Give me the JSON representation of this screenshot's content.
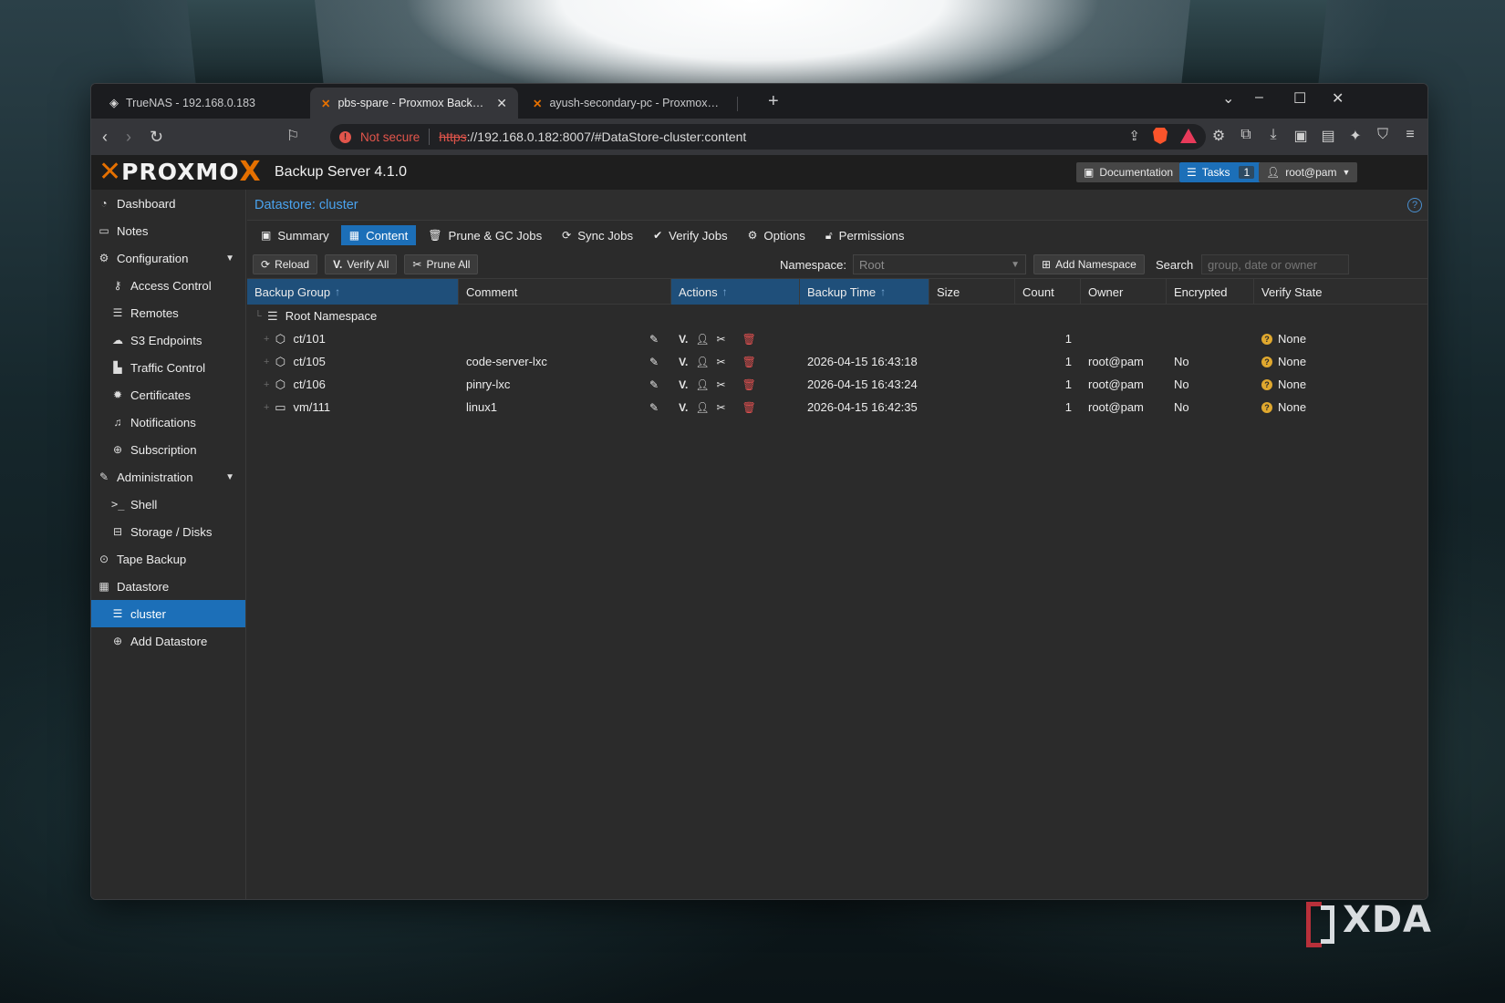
{
  "browser": {
    "tabs": [
      {
        "title": "TrueNAS - 192.168.0.183",
        "icon": "truenas-icon",
        "active": false
      },
      {
        "title": "pbs-spare - Proxmox Backup Ser",
        "icon": "proxmox-icon",
        "active": true
      },
      {
        "title": "ayush-secondary-pc - Proxmox Virtu",
        "icon": "proxmox-icon",
        "active": false
      }
    ],
    "security_label": "Not secure",
    "url_scheme": "https",
    "url_rest": "://192.168.0.182:8007/#DataStore-cluster:content"
  },
  "app": {
    "logo_text_left": "PRO",
    "logo_text_o": "O",
    "logo_text_right": "M",
    "logo_text_end": "X",
    "product": "Backup Server 4.1.0",
    "documentation_label": "Documentation",
    "tasks_label": "Tasks",
    "tasks_count": "1",
    "user_label": "root@pam"
  },
  "sidebar": {
    "items": [
      {
        "label": "Dashboard",
        "icon": "dashboard-icon"
      },
      {
        "label": "Notes",
        "icon": "notes-icon"
      },
      {
        "label": "Configuration",
        "icon": "gears-icon"
      },
      {
        "label": "Access Control",
        "icon": "key-icon"
      },
      {
        "label": "Remotes",
        "icon": "server-icon"
      },
      {
        "label": "S3 Endpoints",
        "icon": "cloud-icon"
      },
      {
        "label": "Traffic Control",
        "icon": "chart-icon"
      },
      {
        "label": "Certificates",
        "icon": "certificate-icon"
      },
      {
        "label": "Notifications",
        "icon": "bell-icon"
      },
      {
        "label": "Subscription",
        "icon": "support-icon"
      },
      {
        "label": "Administration",
        "icon": "wrench-icon"
      },
      {
        "label": "Shell",
        "icon": "terminal-icon"
      },
      {
        "label": "Storage / Disks",
        "icon": "hdd-icon"
      },
      {
        "label": "Tape Backup",
        "icon": "tape-icon"
      },
      {
        "label": "Datastore",
        "icon": "archive-icon"
      },
      {
        "label": "cluster",
        "icon": "database-icon"
      },
      {
        "label": "Add Datastore",
        "icon": "plus-circle-icon"
      }
    ]
  },
  "datastore": {
    "title": "Datastore: cluster",
    "tabs": [
      "Summary",
      "Content",
      "Prune & GC Jobs",
      "Sync Jobs",
      "Verify Jobs",
      "Options",
      "Permissions"
    ],
    "toolbar": {
      "reload": "Reload",
      "verify_all": "Verify All",
      "prune_all": "Prune All",
      "namespace_label": "Namespace:",
      "namespace_value": "Root",
      "add_namespace": "Add Namespace",
      "search_label": "Search",
      "search_placeholder": "group, date or owner"
    },
    "columns": [
      "Backup Group",
      "Comment",
      "Actions",
      "Backup Time",
      "Size",
      "Count",
      "Owner",
      "Encrypted",
      "Verify State"
    ],
    "root_label": "Root Namespace",
    "rows": [
      {
        "group": "ct/101",
        "type": "container",
        "comment": "",
        "time": "",
        "size": "",
        "count": "1",
        "owner": "",
        "encrypted": "",
        "verify": "None"
      },
      {
        "group": "ct/105",
        "type": "container",
        "comment": "code-server-lxc",
        "time": "2026-04-15 16:43:18",
        "size": "",
        "count": "1",
        "owner": "root@pam",
        "encrypted": "No",
        "verify": "None"
      },
      {
        "group": "ct/106",
        "type": "container",
        "comment": "pinry-lxc",
        "time": "2026-04-15 16:43:24",
        "size": "",
        "count": "1",
        "owner": "root@pam",
        "encrypted": "No",
        "verify": "None"
      },
      {
        "group": "vm/111",
        "type": "vm",
        "comment": "linux1",
        "time": "2026-04-15 16:42:35",
        "size": "",
        "count": "1",
        "owner": "root@pam",
        "encrypted": "No",
        "verify": "None"
      }
    ]
  },
  "watermark": "XDA"
}
